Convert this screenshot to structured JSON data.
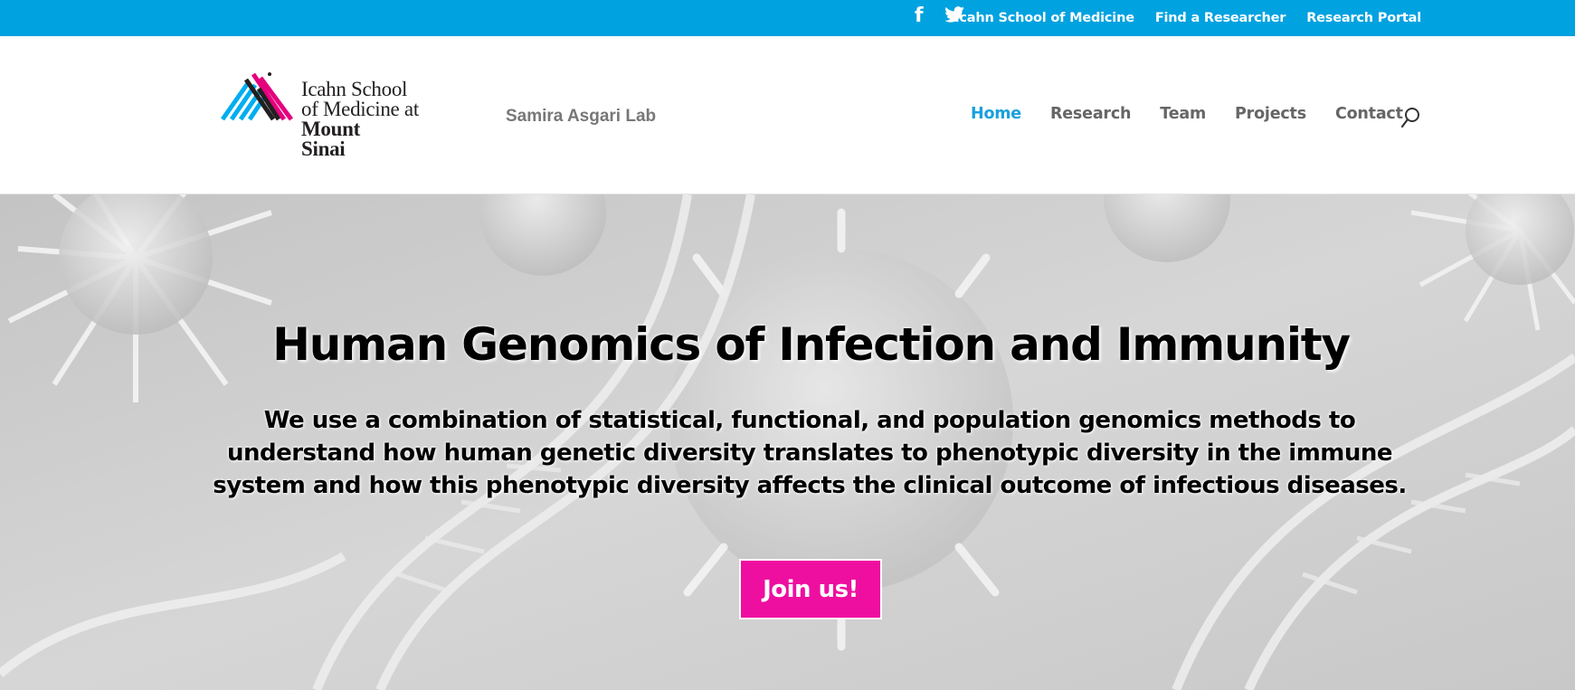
{
  "topbar": {
    "bg_color": "#00a2e0",
    "social": [
      {
        "icon": "facebook-icon",
        "glyph": "f"
      },
      {
        "icon": "twitter-icon"
      }
    ],
    "links": [
      "Icahn School of Medicine",
      "Find a Researcher",
      "Research Portal"
    ]
  },
  "header": {
    "logo": {
      "lines": [
        "Icahn School",
        "of Medicine at",
        "Mount",
        "Sinai"
      ],
      "mark_colors": [
        "#00aeef",
        "#e5007e",
        "#221f20"
      ]
    },
    "lab_name": "Samira Asgari Lab",
    "nav": {
      "items": [
        "Home",
        "Research",
        "Team",
        "Projects",
        "Contact"
      ],
      "active": "Home",
      "active_color": "#1aa0dd"
    },
    "search_icon": "search-icon"
  },
  "hero": {
    "title": "Human Genomics of Infection and Immunity",
    "description": "We use a combination of statistical, functional, and population genomics methods to understand how human genetic diversity translates to phenotypic diversity in the immune system and how this phenotypic diversity affects the clinical outcome of infectious diseases.",
    "button_label": "Join us!",
    "button_color": "#ee0fa0",
    "background": "grayscale virus and DNA illustration"
  }
}
